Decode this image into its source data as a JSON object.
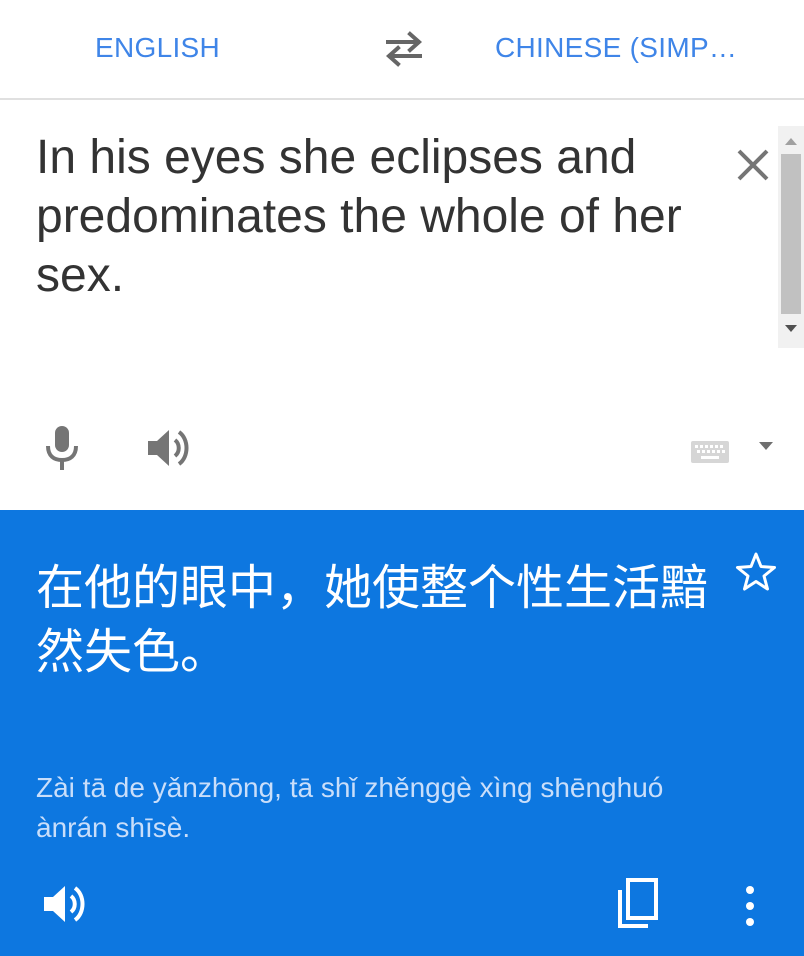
{
  "header": {
    "source_language": "ENGLISH",
    "target_language": "CHINESE (SIMP…",
    "swap_icon": "swap-arrows-icon"
  },
  "input": {
    "text": "In his eyes she eclipses and predominates the whole of her sex.",
    "clear_icon": "close-icon",
    "mic_icon": "mic-icon",
    "speaker_icon": "speaker-icon",
    "keyboard_icon": "keyboard-icon"
  },
  "result": {
    "translation": "在他的眼中，她使整个性生活黯然失色。",
    "transliteration": "Zài tā de yǎnzhōng, tā shǐ zhěnggè xìng shēnghuó ànrán shīsè.",
    "star_icon": "star-outline-icon",
    "copy_icon": "copy-icon",
    "more_icon": "more-vert-icon"
  },
  "colors": {
    "accent": "#3f85e8",
    "result_background": "#0d77e0",
    "input_text": "#333333",
    "transliteration": "#c9defa"
  }
}
